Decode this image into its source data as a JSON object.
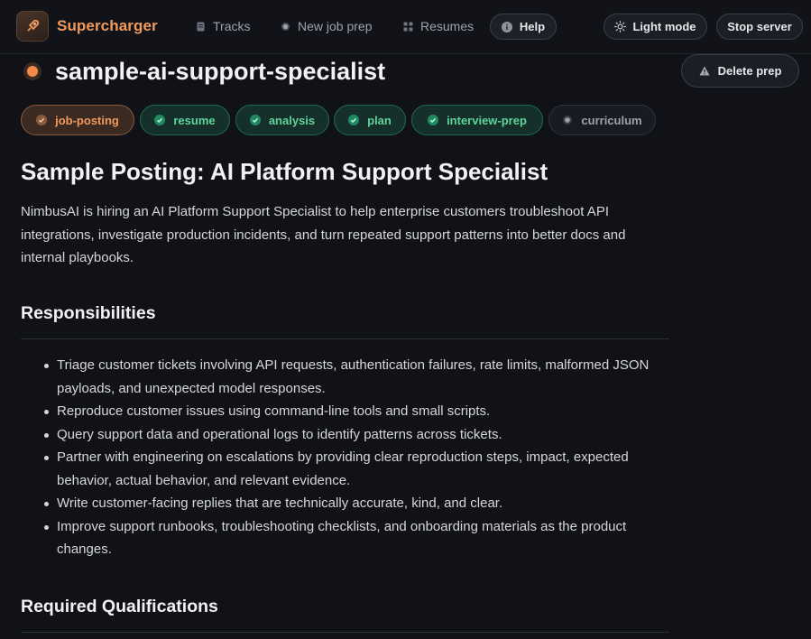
{
  "nav": {
    "brand": "Supercharger",
    "items": [
      {
        "label": "Tracks",
        "icon": "document-icon"
      },
      {
        "label": "New job prep",
        "icon": "dot-icon"
      },
      {
        "label": "Resumes",
        "icon": "grid-icon"
      }
    ],
    "help": "Help",
    "light_mode": "Light mode",
    "stop_server": "Stop server"
  },
  "page": {
    "title": "sample-ai-support-specialist",
    "delete": "Delete prep"
  },
  "stages": [
    {
      "label": "job-posting",
      "state": "active"
    },
    {
      "label": "resume",
      "state": "done"
    },
    {
      "label": "analysis",
      "state": "done"
    },
    {
      "label": "plan",
      "state": "done"
    },
    {
      "label": "interview-prep",
      "state": "done"
    },
    {
      "label": "curriculum",
      "state": "pending"
    }
  ],
  "doc": {
    "heading": "Sample Posting: AI Platform Support Specialist",
    "intro": "NimbusAI is hiring an AI Platform Support Specialist to help enterprise customers troubleshoot API integrations, investigate production incidents, and turn repeated support patterns into better docs and internal playbooks.",
    "responsibilities_heading": "Responsibilities",
    "responsibilities": [
      "Triage customer tickets involving API requests, authentication failures, rate limits, malformed JSON payloads, and unexpected model responses.",
      "Reproduce customer issues using command-line tools and small scripts.",
      "Query support data and operational logs to identify patterns across tickets.",
      "Partner with engineering on escalations by providing clear reproduction steps, impact, expected behavior, actual behavior, and relevant evidence.",
      "Write customer-facing replies that are technically accurate, kind, and clear.",
      "Improve support runbooks, troubleshooting checklists, and onboarding materials as the product changes."
    ],
    "required_heading": "Required Qualifications"
  },
  "colors": {
    "background": "#101217",
    "accent": "#f29a5b",
    "success": "#5fd39c"
  }
}
